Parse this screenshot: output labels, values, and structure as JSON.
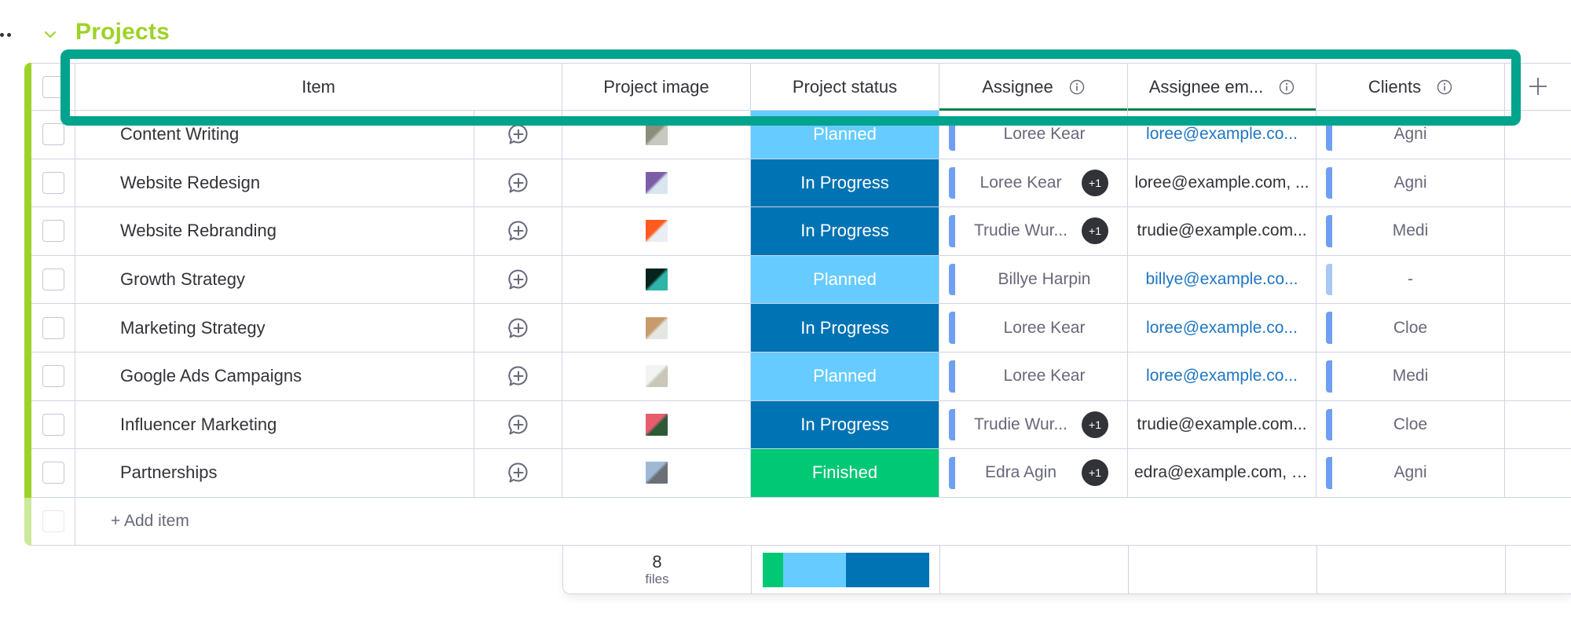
{
  "group": {
    "title": "Projects",
    "color": "#9cd326",
    "menu_icon": "more-dots-icon",
    "collapse_icon": "chevron-down-icon"
  },
  "columns": {
    "item": "Item",
    "project_image": "Project image",
    "project_status": "Project status",
    "assignee": "Assignee",
    "assignee_email": "Assignee em...",
    "clients": "Clients",
    "add_column_icon": "plus-icon"
  },
  "status_colors": {
    "Planned": "#66ccff",
    "In Progress": "#0073b4",
    "Finished": "#00c875"
  },
  "rows": [
    {
      "item": "Content Writing",
      "image_colors": [
        "#8a8f7c",
        "#c8c8c0"
      ],
      "status": "Planned",
      "assignee": "Loree Kear",
      "extra": "",
      "email": "loree@example.co...",
      "email_link": true,
      "client": "Agni"
    },
    {
      "item": "Website Redesign",
      "image_colors": [
        "#7b5ea7",
        "#d9e6ef"
      ],
      "status": "In Progress",
      "assignee": "Loree Kear",
      "extra": "+1",
      "email": "loree@example.com, ...",
      "email_link": false,
      "client": "Agni"
    },
    {
      "item": "Website Rebranding",
      "image_colors": [
        "#ff5a1f",
        "#e9eef3"
      ],
      "status": "In Progress",
      "assignee": "Trudie Wur...",
      "extra": "+1",
      "email": "trudie@example.com...",
      "email_link": false,
      "client": "Medi"
    },
    {
      "item": "Growth Strategy",
      "image_colors": [
        "#06221c",
        "#2fb5a8"
      ],
      "status": "Planned",
      "assignee": "Billye Harpin",
      "extra": "",
      "email": "billye@example.co...",
      "email_link": true,
      "client": "-"
    },
    {
      "item": "Marketing Strategy",
      "image_colors": [
        "#c89b6c",
        "#e4e6e2"
      ],
      "status": "In Progress",
      "assignee": "Loree Kear",
      "extra": "",
      "email": "loree@example.co...",
      "email_link": true,
      "client": "Cloe"
    },
    {
      "item": "Google Ads Campaigns",
      "image_colors": [
        "#f2f3f3",
        "#c9c7b8"
      ],
      "status": "Planned",
      "assignee": "Loree Kear",
      "extra": "",
      "email": "loree@example.co...",
      "email_link": true,
      "client": "Medi"
    },
    {
      "item": "Influencer Marketing",
      "image_colors": [
        "#e85d6e",
        "#2d5a35"
      ],
      "status": "In Progress",
      "assignee": "Trudie Wur...",
      "extra": "+1",
      "email": "trudie@example.com...",
      "email_link": false,
      "client": "Cloe"
    },
    {
      "item": "Partnerships",
      "image_colors": [
        "#9fb8d6",
        "#6b6f76"
      ],
      "status": "Finished",
      "assignee": "Edra Agin",
      "extra": "+1",
      "email": "edra@example.com, r...",
      "email_link": false,
      "client": "Agni"
    }
  ],
  "add_item_label": "+ Add item",
  "summary": {
    "files_count": "8",
    "files_label": "files",
    "status_distribution": [
      {
        "status": "Finished",
        "count": 1
      },
      {
        "status": "Planned",
        "count": 3
      },
      {
        "status": "In Progress",
        "count": 4
      }
    ]
  }
}
